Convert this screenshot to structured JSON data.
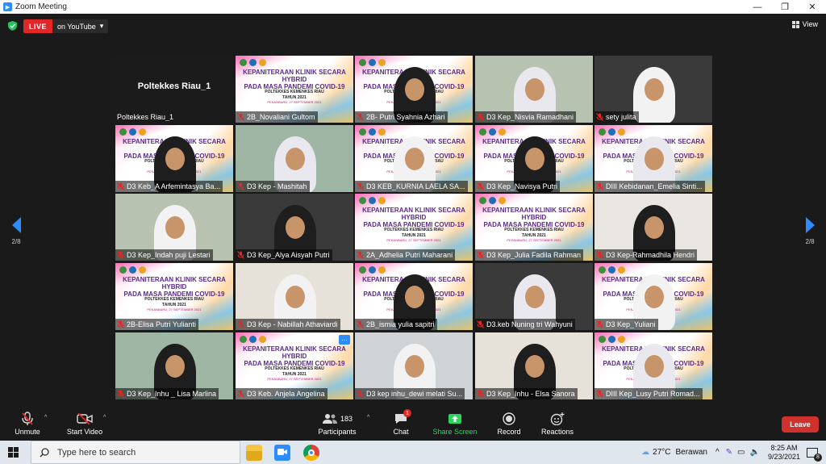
{
  "window": {
    "title": "Zoom Meeting"
  },
  "topbar": {
    "live_label": "LIVE",
    "stream_label": "on YouTube",
    "view_label": "View"
  },
  "nav": {
    "left_page": "2/8",
    "right_page": "2/8"
  },
  "banner": {
    "line1": "KEPANITERAAN KLINIK SECARA HYBRID",
    "line2": "PADA MASA PANDEMI COVID-19",
    "line3": "POLTEKKES KEMENKES RIAU",
    "line4": "TAHUN 2021",
    "line5": "PEKANBARU, 27 SEPTEMBER 2021"
  },
  "host_tile": {
    "display_name": "Poltekkes Riau_1",
    "name": "Poltekkes Riau_1"
  },
  "participants": [
    {
      "name": "2B_Novaliani Gultom",
      "kind": "banner"
    },
    {
      "name": "2B- Putri Syahnia Azhari",
      "kind": "banner-person"
    },
    {
      "name": "D3 Kep_Nisvia Ramadhani",
      "kind": "person"
    },
    {
      "name": "sety julita",
      "kind": "person"
    },
    {
      "name": "D3 Keb_A Arfemintasya Ba...",
      "kind": "banner-person"
    },
    {
      "name": "D3 Kep - Mashitah",
      "kind": "person"
    },
    {
      "name": "D3 KEB_KURNIA LAELA SA...",
      "kind": "banner-person"
    },
    {
      "name": "D3 Kep_Navisya Putri",
      "kind": "banner-person"
    },
    {
      "name": "DIII Kebidanan_Emelia Sinti...",
      "kind": "banner-person"
    },
    {
      "name": "D3 Kep_Indah puji Lestari",
      "kind": "person"
    },
    {
      "name": "D3 Kep_Alya Aisyah Putri",
      "kind": "person"
    },
    {
      "name": "2A_Adhelia Putri Maharani",
      "kind": "banner"
    },
    {
      "name": "D3 Kep_Julia Fadila Rahman",
      "kind": "banner"
    },
    {
      "name": "D3 Kep-Rahmadhila Hendri",
      "kind": "person"
    },
    {
      "name": "2B-Elisa Putri Yulianti",
      "kind": "banner"
    },
    {
      "name": "D3 Kep - Nabillah Athaviardi",
      "kind": "person"
    },
    {
      "name": "2B_ismia yulia sapitri",
      "kind": "banner-person"
    },
    {
      "name": "D3.keb Nuning tri Wahyuni",
      "kind": "person"
    },
    {
      "name": "D3 Kep_Yuliani",
      "kind": "banner-person"
    },
    {
      "name": "D3 Kep_Inhu _ Lisa Marlina",
      "kind": "person"
    },
    {
      "name": "D3 Keb. Anjela Angelina",
      "kind": "banner"
    },
    {
      "name": "D3 kep inhu_dewi melati Su...",
      "kind": "person"
    },
    {
      "name": "D3 Kep_Inhu - Elsa Sanora",
      "kind": "person"
    },
    {
      "name": "DIII Kep_Lusy Putri Romad...",
      "kind": "banner-person"
    }
  ],
  "toolbar": {
    "unmute": "Unmute",
    "start_video": "Start Video",
    "participants": "Participants",
    "participant_count": "183",
    "chat": "Chat",
    "chat_badge": "1",
    "share_screen": "Share Screen",
    "record": "Record",
    "reactions": "Reactions",
    "leave": "Leave",
    "more_dots": "..."
  },
  "taskbar": {
    "search_placeholder": "Type here to search",
    "temperature": "27°C",
    "weather": "Berawan",
    "time": "8:25 AM",
    "date": "9/23/2021",
    "notification_count": "8"
  },
  "colors": {
    "accent": "#2d8cff",
    "leave": "#d0312d",
    "live": "#e02828",
    "share": "#23d959"
  }
}
